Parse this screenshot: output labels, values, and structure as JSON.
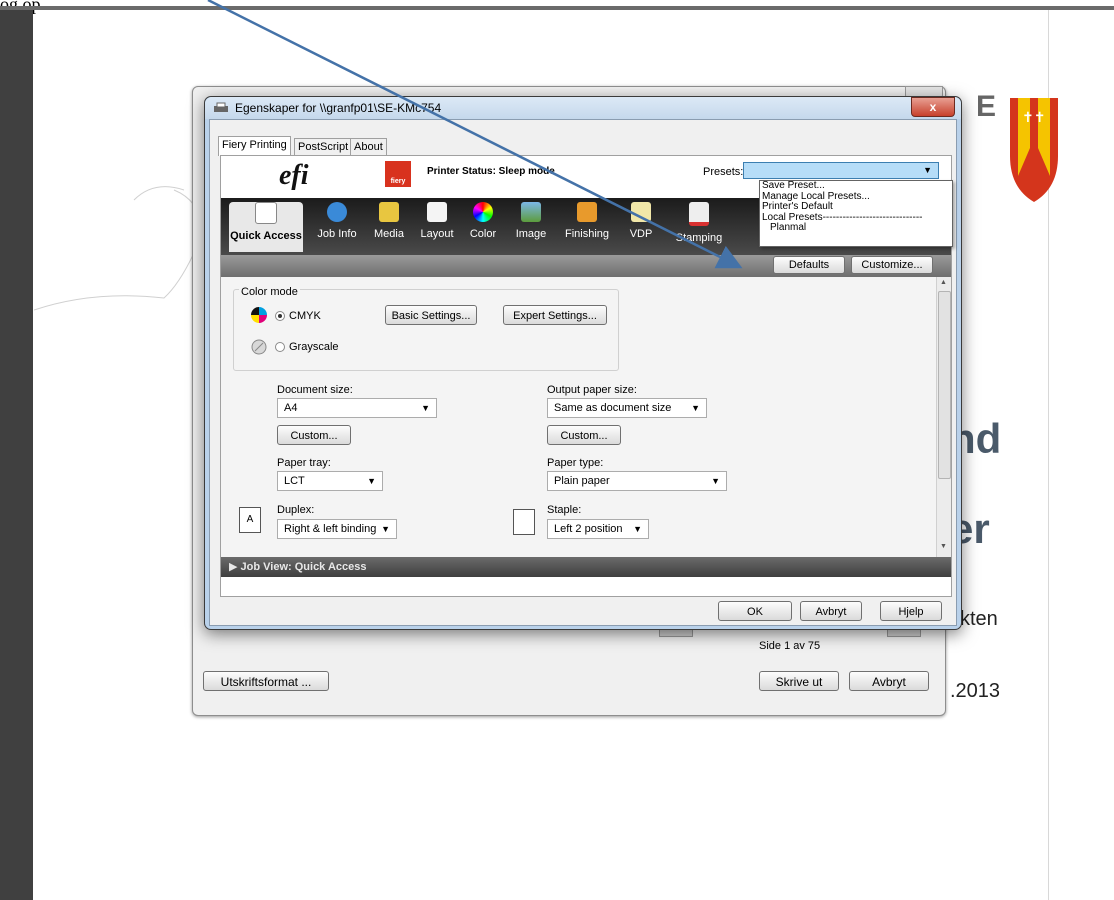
{
  "top_text": "og op",
  "background_doc": {
    "big_fragment1": "nd",
    "big_fragment2": "er",
    "fragment_kten": "kten",
    "fragment_date": ".2013",
    "logo_letter": "E"
  },
  "print_dialog": {
    "page_info": "Side 1 av 75",
    "page_setup_button": "Utskriftsformat ...",
    "print_button": "Skrive ut",
    "cancel_button": "Avbryt"
  },
  "window": {
    "title": "Egenskaper for \\\\granfp01\\SE-KMc754",
    "close_label": "x",
    "tabs": [
      "Fiery Printing",
      "PostScript",
      "About"
    ],
    "printer_status": "Printer Status: Sleep mode",
    "presets_label": "Presets:",
    "presets_value": "",
    "preset_options": [
      "Save Preset...",
      "Manage Local Presets...",
      "Printer's Default",
      "Local Presets------------------------------",
      "Planmal"
    ],
    "logo_text": "efi",
    "fiery_text": "fiery",
    "icon_tabs": [
      "Quick Access",
      "Job Info",
      "Media",
      "Layout",
      "Color",
      "Image",
      "Finishing",
      "VDP",
      "Stamping"
    ],
    "defaults_button": "Defaults",
    "customize_button": "Customize...",
    "color_mode_label": "Color mode",
    "cmyk_label": "CMYK",
    "grayscale_label": "Grayscale",
    "basic_settings_button": "Basic Settings...",
    "expert_settings_button": "Expert Settings...",
    "document_size_label": "Document size:",
    "document_size_value": "A4",
    "custom_button": "Custom...",
    "output_paper_size_label": "Output paper size:",
    "output_paper_size_value": "Same as document size",
    "paper_tray_label": "Paper tray:",
    "paper_tray_value": "LCT",
    "paper_type_label": "Paper type:",
    "paper_type_value": "Plain paper",
    "duplex_label": "Duplex:",
    "duplex_value": "Right & left binding",
    "staple_label": "Staple:",
    "staple_value": "Left 2 position",
    "job_view_label": "Job View: Quick Access",
    "ok_button": "OK",
    "cancel_button": "Avbryt",
    "help_button": "Hjelp"
  },
  "colors": {
    "window_frame": "#b9d1ea",
    "icon_bar": "#2b2b2b",
    "shield_red": "#d4351c",
    "shield_yellow": "#f5c400",
    "arrow_blue": "#4472a8"
  }
}
